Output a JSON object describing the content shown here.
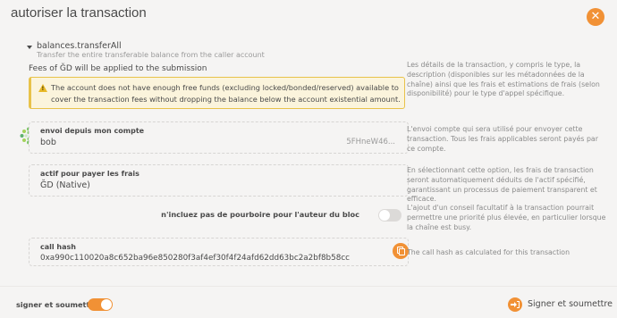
{
  "modal": {
    "title": "autoriser la transaction",
    "close_icon": "close-icon"
  },
  "transaction": {
    "method": "balances.transferAll",
    "description": "Transfer the entire transferable balance from the caller account",
    "fees_notice": "Fees of ĞD will be applied to the submission",
    "warning": "The account does not have enough free funds (excluding locked/bonded/reserved) available to cover the transaction fees without dropping the balance below the account existential amount.",
    "help": "Les détails de la transaction, y compris le type, la description (disponibles sur les métadonnées de la chaîne) ainsi que les frais et estimations de frais (selon disponibilité) pour le type d'appel spécifique."
  },
  "sender": {
    "label": "envoi depuis mon compte",
    "name": "bob",
    "address": "5FHneW46...",
    "help": "L'envoi compte qui sera utilisé pour envoyer cette transaction. Tous les frais applicables seront payés par ce compte."
  },
  "fee_asset": {
    "label": "actif pour payer les frais",
    "value": "ĞD (Native)",
    "help": "En sélectionnant cette option, les frais de transaction seront automatiquement déduits de l'actif spécifié, garantissant un processus de paiement transparent et efficace."
  },
  "tip": {
    "label": "n'incluez pas de pourboire pour l'auteur du bloc",
    "enabled": false,
    "help": "L'ajout d'un conseil facultatif à la transaction pourrait permettre une priorité plus élevée, en particulier lorsque la chaîne est busy."
  },
  "call_hash": {
    "label": "call hash",
    "value": "0xa990c110020a8c652ba96e850280f3af4ef30f4f24afd62dd63bc2a2bf8b58cc",
    "help": "The call hash as calculated for this transaction"
  },
  "footer": {
    "sign_label": "signer et soumettre",
    "sign_enabled": true,
    "submit_label": "Signer et soumettre"
  },
  "colors": {
    "accent": "#f19135",
    "warning_border": "#e8c24a",
    "warning_bg": "#fbf4dc",
    "background": "#f5f4f3"
  }
}
